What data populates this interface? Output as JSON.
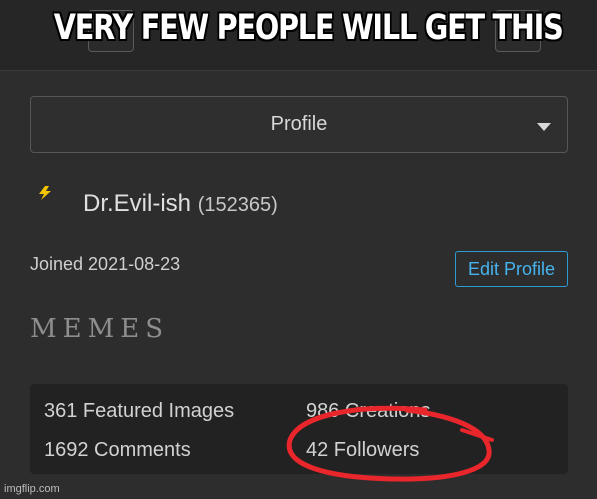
{
  "meme": {
    "caption": "VERY FEW PEOPLE WILL GET THIS"
  },
  "profile_menu": {
    "selected": "Profile"
  },
  "user": {
    "name": "Dr.Evil-ish",
    "points": "(152365)",
    "joined": "Joined 2021-08-23"
  },
  "actions": {
    "edit_profile": "Edit Profile"
  },
  "section_title": "MEMES",
  "stats": {
    "featured_images": "361 Featured Images",
    "creations": "986 Creations",
    "comments": "1692 Comments",
    "followers": "42 Followers"
  },
  "watermark": "imgflip.com",
  "colors": {
    "background": "#2d2d2d",
    "accent_blue": "#45b4ee",
    "circle_red": "#e8262b",
    "bolt_yellow": "#f5c400"
  },
  "icons": {
    "status_icon": "lightning-bolt-icon",
    "dropdown_icon": "caret-down-icon"
  }
}
